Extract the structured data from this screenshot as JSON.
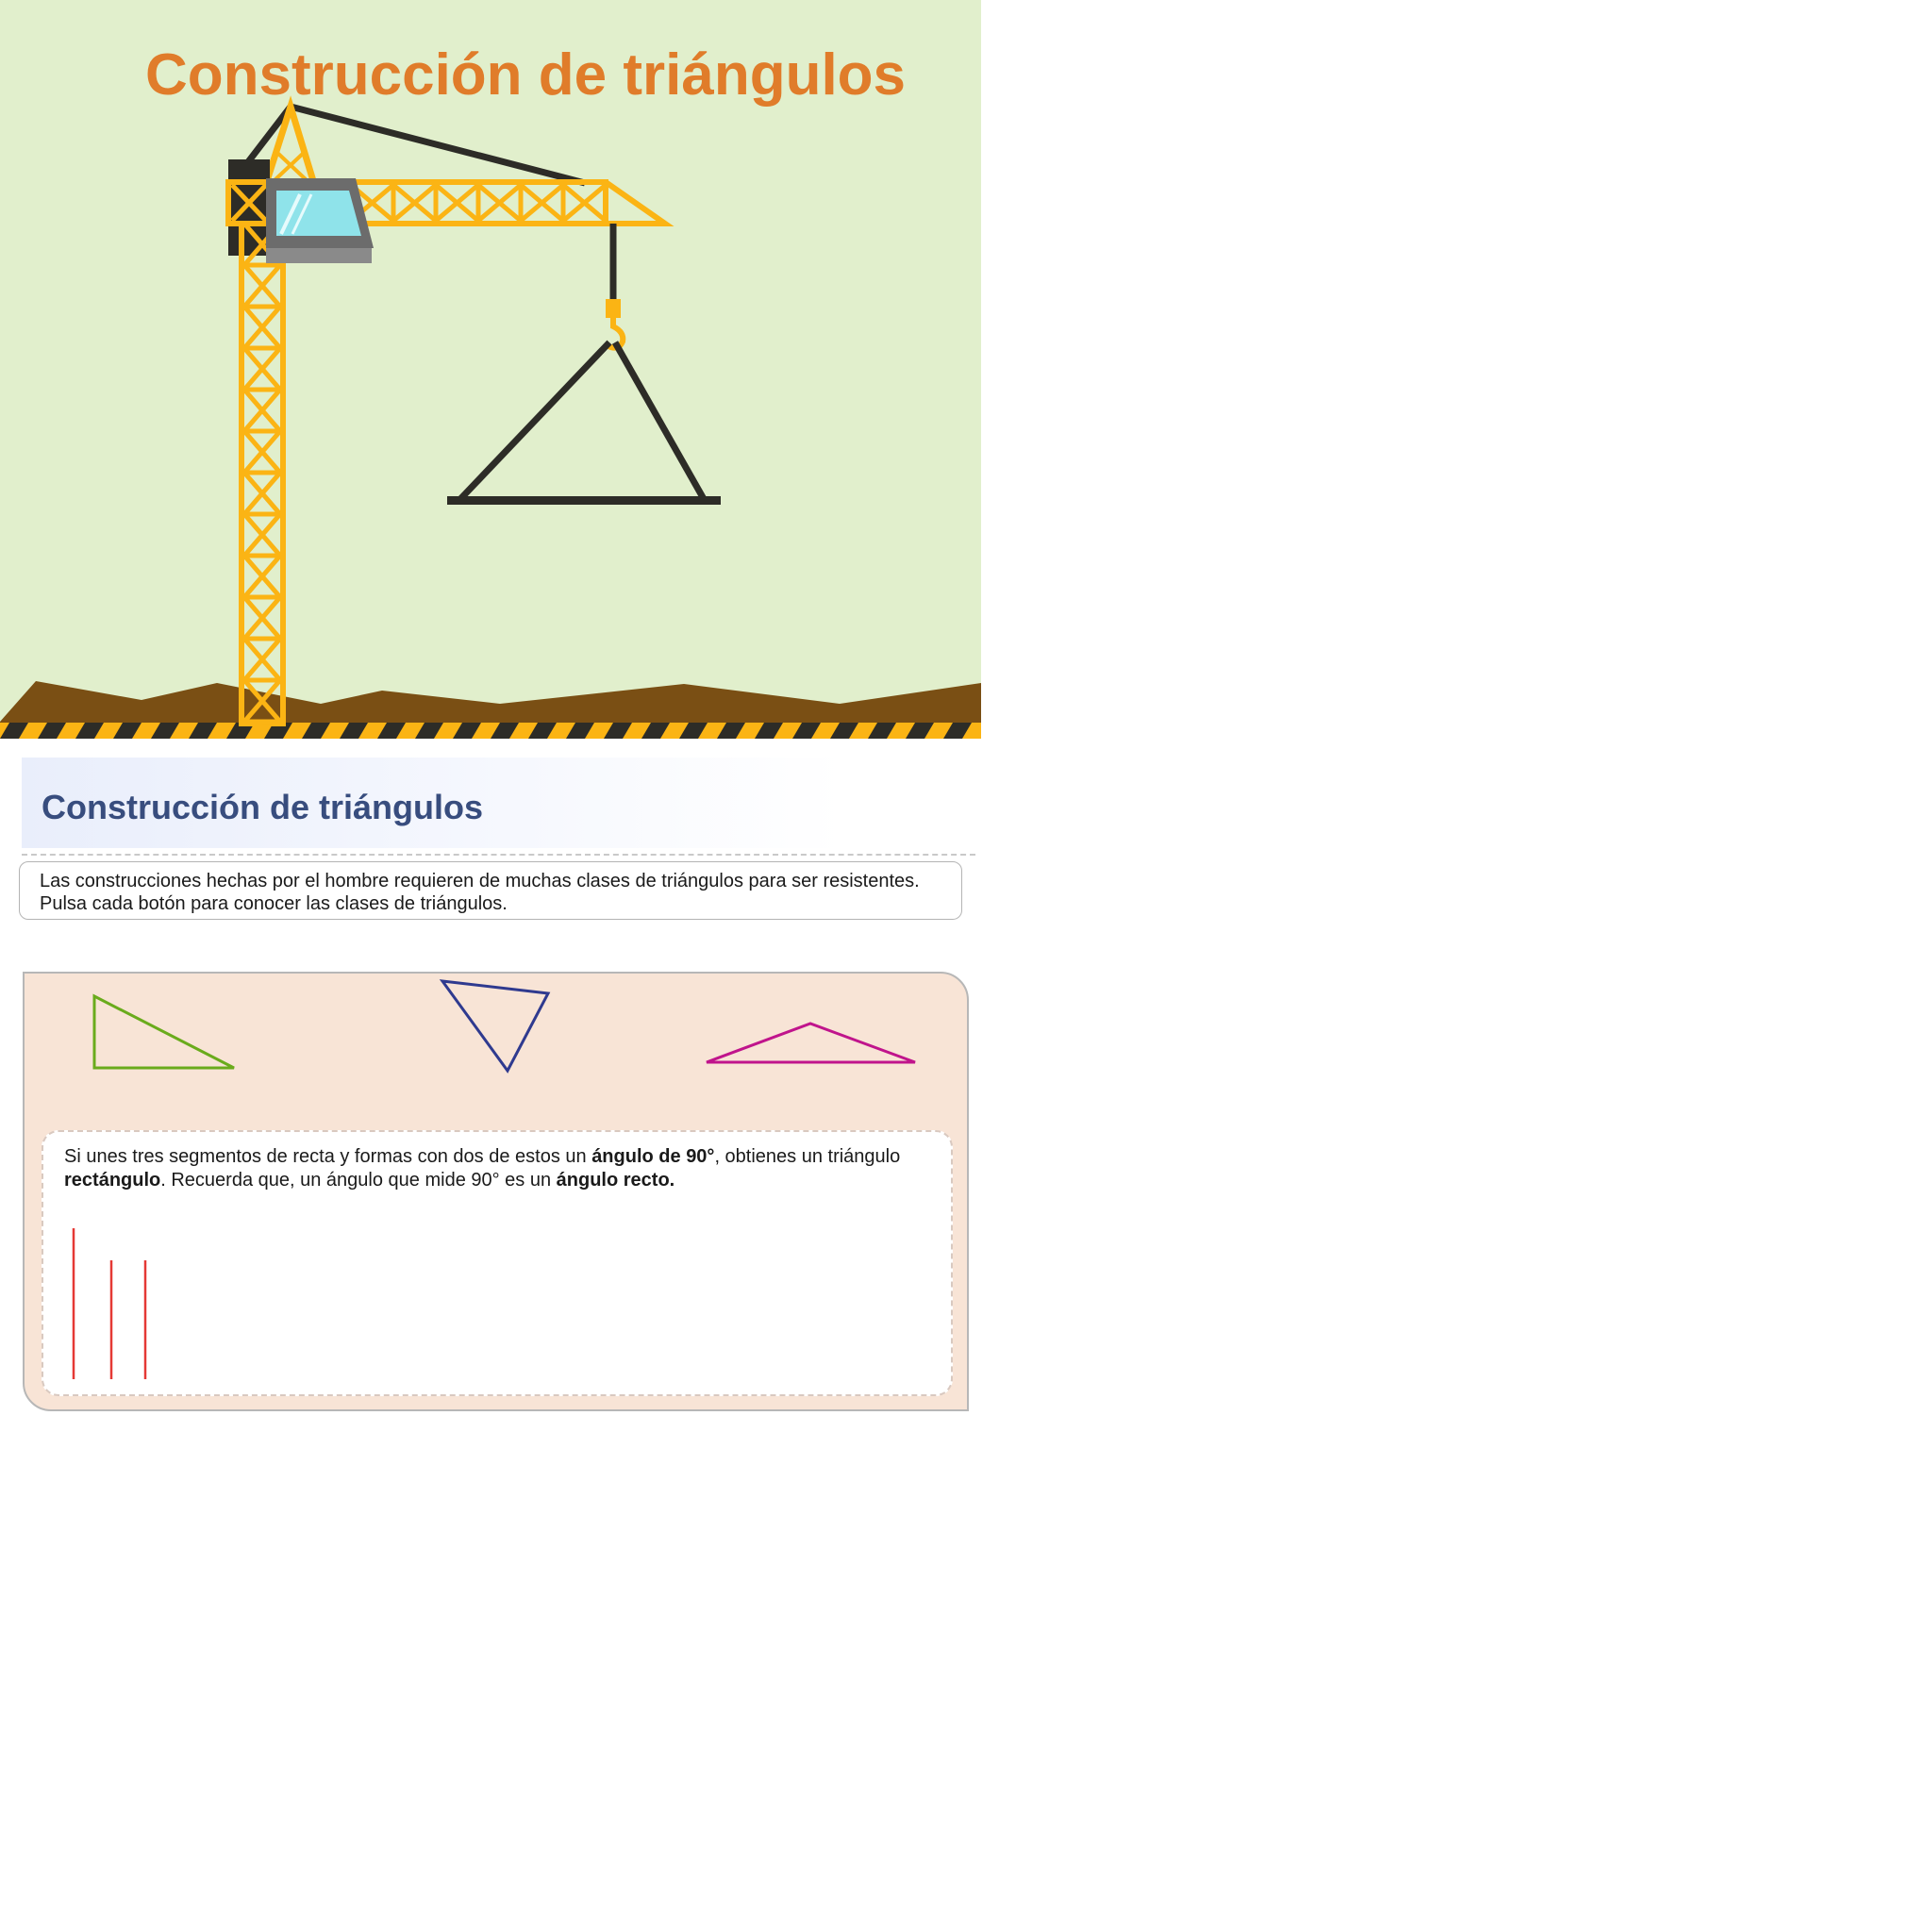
{
  "hero": {
    "title": "Construcción de triángulos",
    "colors": {
      "sky": "#e1efcc",
      "ground": "#7a4f14",
      "crane": "#fbb414",
      "cable": "#2d2c27",
      "hazard_dark": "#2d2c27",
      "hazard_light": "#fbb414"
    }
  },
  "section": {
    "title": "Construcción de triángulos"
  },
  "intro": {
    "line1": "Las construcciones hechas por el hombre requieren de muchas clases de triángulos para ser resistentes.",
    "line2": "Pulsa cada botón para conocer las clases de triángulos."
  },
  "triangle_buttons": [
    {
      "name": "right-triangle",
      "color": "#6aab1c"
    },
    {
      "name": "acute-triangle",
      "color": "#2f3a8f"
    },
    {
      "name": "obtuse-triangle",
      "color": "#c0148c"
    }
  ],
  "info": {
    "text_1": "Si unes tres segmentos de recta y formas con dos de estos un ",
    "bold_1": "ángulo de 90°",
    "text_2": ", obtienes un triángulo ",
    "bold_2": "rectángulo",
    "text_3": ". Recuerda que, un ángulo que mide 90° es un ",
    "bold_3": "ángulo recto.",
    "segment_color": "#e53935"
  }
}
